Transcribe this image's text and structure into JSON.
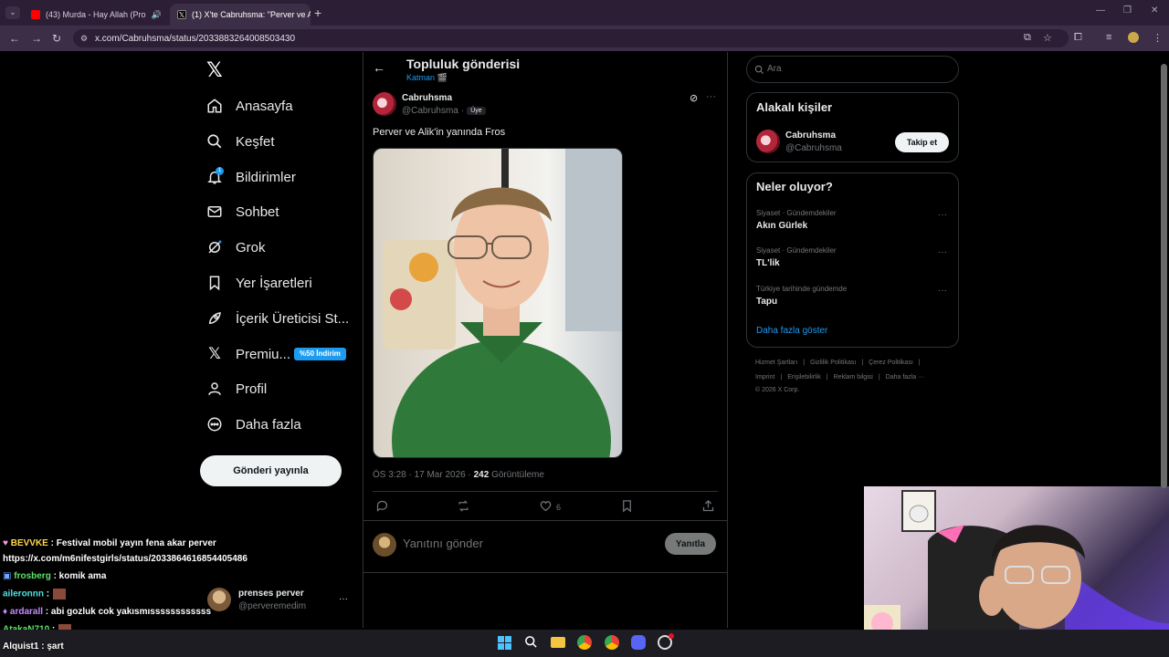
{
  "browser": {
    "tabs": [
      {
        "label": "(43) Murda - Hay Allah (Pro",
        "active": false
      },
      {
        "label": "(1) X'te Cabruhsma: \"Perver ve A",
        "active": true
      }
    ],
    "url": "x.com/Cabruhsma/status/2033883264008503430",
    "accent": "#3d2e47"
  },
  "nav": {
    "items": [
      {
        "label": "Anasayfa",
        "icon": "home-icon"
      },
      {
        "label": "Keşfet",
        "icon": "search-icon"
      },
      {
        "label": "Bildirimler",
        "icon": "bell-icon"
      },
      {
        "label": "Sohbet",
        "icon": "mail-icon"
      },
      {
        "label": "Grok",
        "icon": "grok-icon"
      },
      {
        "label": "Yer İşaretleri",
        "icon": "bookmark-icon"
      },
      {
        "label": "İçerik Üreticisi St...",
        "icon": "rocket-icon"
      },
      {
        "label": "Premiu...",
        "icon": "x-logo-icon"
      },
      {
        "label": "Profil",
        "icon": "person-icon"
      },
      {
        "label": "Daha fazla",
        "icon": "more-circle-icon"
      }
    ],
    "notification_count": "1",
    "premium_badge": "%50 İndirim",
    "post_button": "Gönderi yayınla"
  },
  "header": {
    "title": "Topluluk gönderisi",
    "community": "Katman 🎬"
  },
  "post": {
    "display_name": "Cabruhsma",
    "handle": "@Cabruhsma",
    "handle_sep": "·",
    "role": "Üye",
    "text": "Perver ve Alik'in yanında Fros",
    "timestamp": "ÖS 3:28 · 17 Mar 2026 · ",
    "views_count": "242",
    "views_label": " Görüntüleme",
    "likes": "6"
  },
  "reply": {
    "placeholder": "Yanıtını gönder",
    "button": "Yanıtla"
  },
  "search": {
    "placeholder": "Ara"
  },
  "relevant": {
    "title": "Alakalı kişiler",
    "name": "Cabruhsma",
    "handle": "@Cabruhsma",
    "follow": "Takip et"
  },
  "trends": {
    "title": "Neler oluyor?",
    "items": [
      {
        "context": "Siyaset · Gündemdekiler",
        "topic": "Akın Gürlek"
      },
      {
        "context": "Siyaset · Gündemdekiler",
        "topic": "TL'lik"
      },
      {
        "context": "Türkiye tarihinde gündemde",
        "topic": "Tapu"
      }
    ],
    "show_more": "Daha fazla göster"
  },
  "footer": {
    "links1": [
      "Hizmet Şartları",
      "Gizlilik Politikası",
      "Çerez Politikası"
    ],
    "links2": [
      "Imprint",
      "Erişilebilirlik",
      "Reklam bilgisi",
      "Daha fazla ···"
    ],
    "copyright": "© 2026 X Corp."
  },
  "chat": [
    {
      "user": "BEVVKE",
      "color": "#ffd84a",
      "msg": " : Festival mobil yayın fena akar perver"
    },
    {
      "user": "",
      "color": "#fff",
      "msg": "https://x.com/m6nifestgirls/status/2033864616854405486"
    },
    {
      "user": "frosberg",
      "color": "#5ee36a",
      "msg": " : komik ama"
    },
    {
      "user": "aileronnn",
      "color": "#4ee0e0",
      "msg": " :"
    },
    {
      "user": "ardarall",
      "color": "#c58cff",
      "msg": " : abi gozluk cok yakısmıssssssssssss"
    },
    {
      "user": "AtakaN710",
      "color": "#5ee36a",
      "msg": " :"
    },
    {
      "user": "Alquist1",
      "color": "#fff",
      "msg": " : şart"
    }
  ],
  "suggestion": {
    "name": "prenses perver",
    "handle": "@perveremedim"
  }
}
